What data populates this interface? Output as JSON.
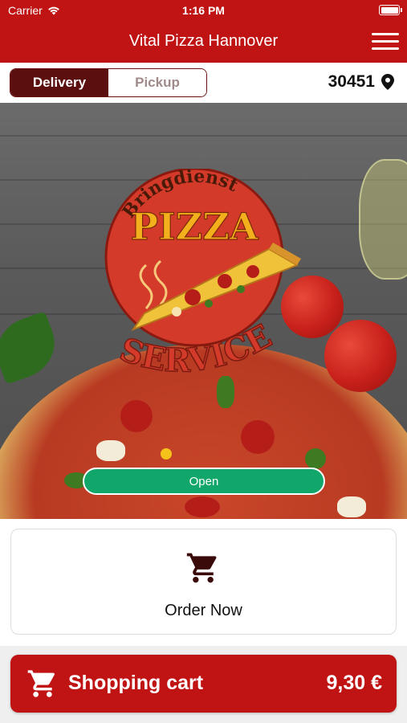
{
  "status_bar": {
    "carrier": "Carrier",
    "time": "1:16 PM"
  },
  "header": {
    "title": "Vital Pizza Hannover",
    "menu_icon": "hamburger-menu-icon"
  },
  "mode_toggle": {
    "delivery_label": "Delivery",
    "pickup_label": "Pickup",
    "selected": "Delivery"
  },
  "location": {
    "zip": "30451",
    "icon": "location-pin-icon"
  },
  "hero": {
    "logo": {
      "top_text": "Bringdienst",
      "main_text": "PIZZA",
      "bottom_text": "SERVICE"
    },
    "status_label": "Open"
  },
  "order": {
    "label": "Order Now",
    "icon": "cart-icon"
  },
  "cart": {
    "label": "Shopping cart",
    "total": "9,30 €",
    "icon": "cart-icon"
  },
  "colors": {
    "brand_red": "#c01414",
    "dark_red": "#5b0f0f",
    "open_green": "#12a76a"
  }
}
